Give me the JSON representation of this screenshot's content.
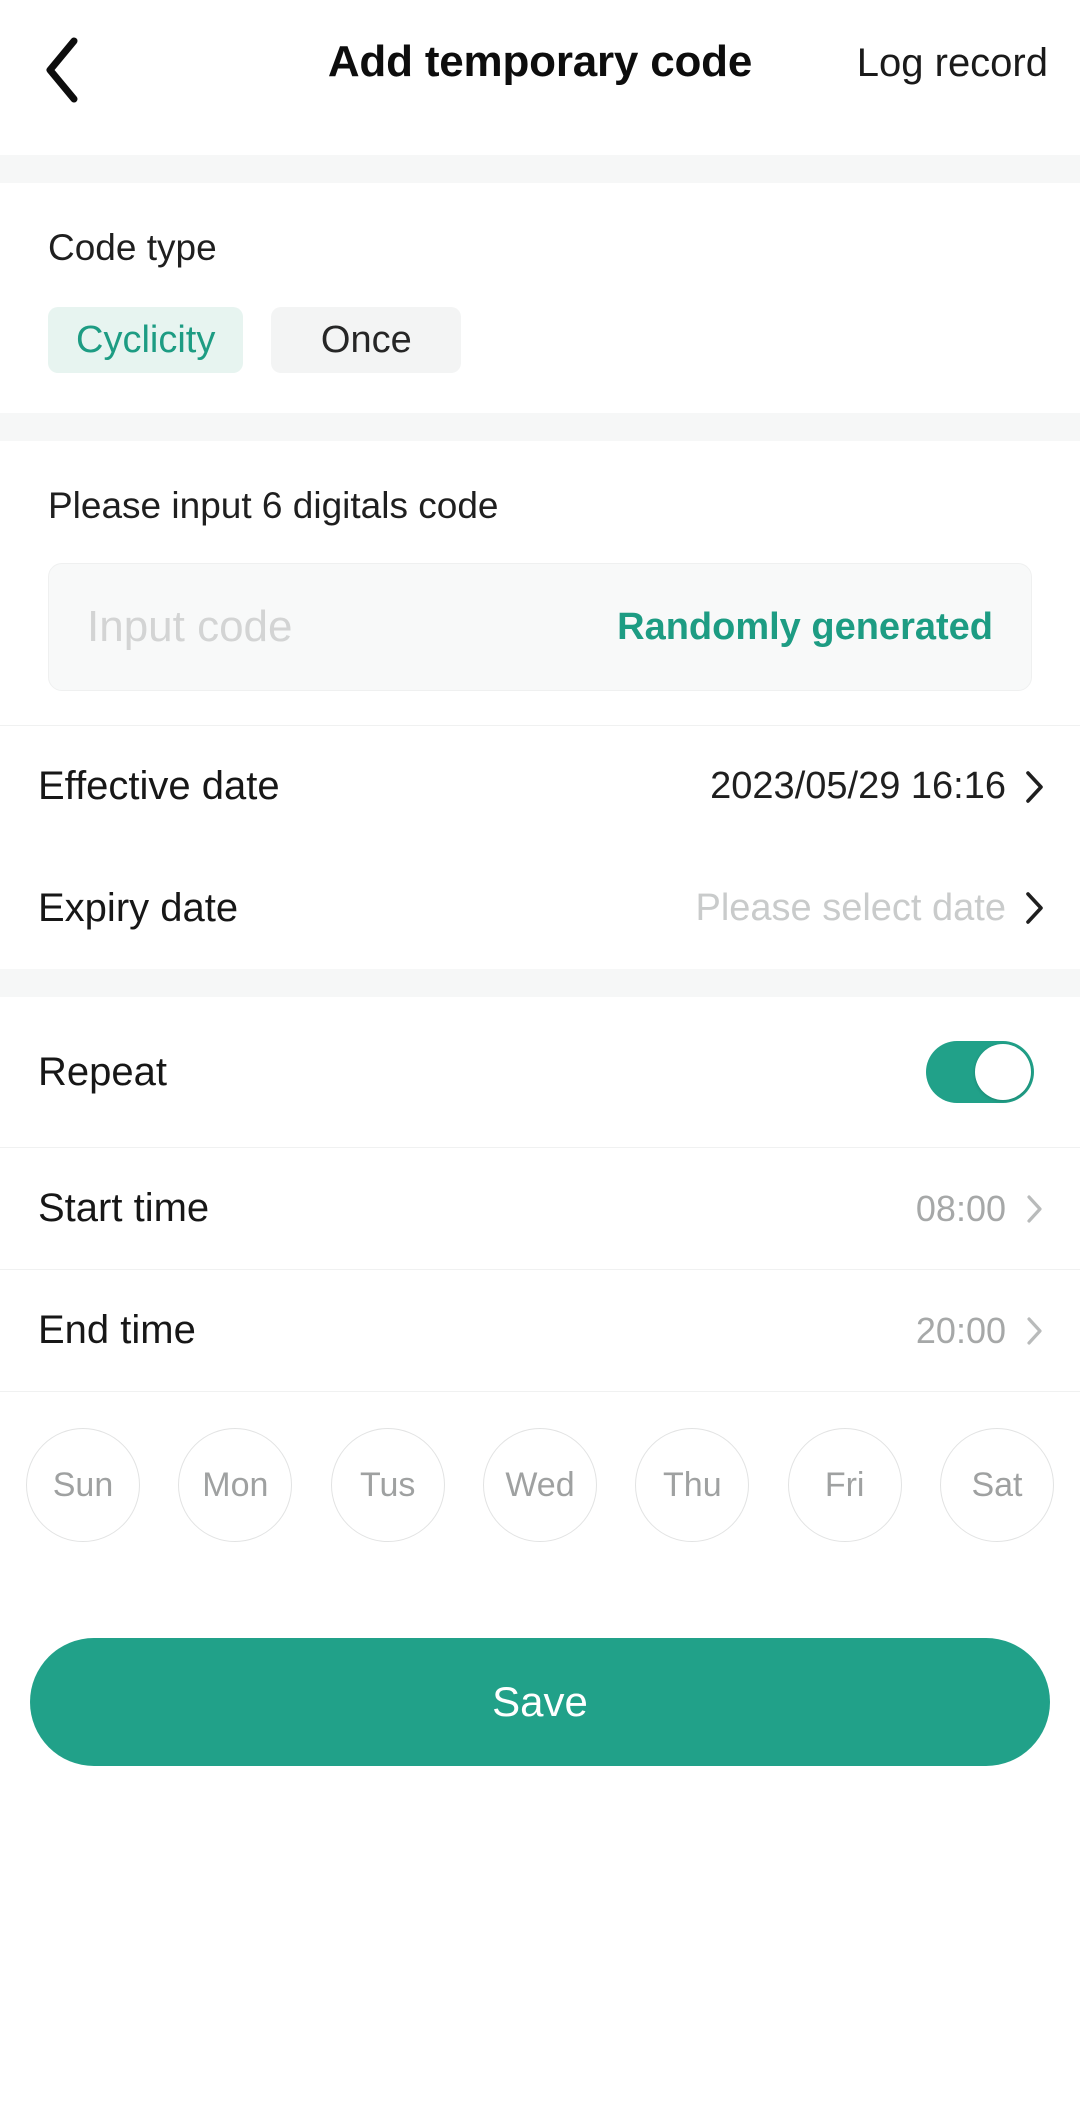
{
  "header": {
    "back_icon": "chevron-left-icon",
    "title": "Add temporary code",
    "log_record_label": "Log record"
  },
  "code_type": {
    "label": "Code type",
    "options": [
      {
        "label": "Cyclicity",
        "selected": true
      },
      {
        "label": "Once",
        "selected": false
      }
    ]
  },
  "code_input": {
    "hint": "Please input 6 digitals code",
    "value": "",
    "placeholder": "Input code",
    "random_button_label": "Randomly generated"
  },
  "dates": {
    "effective": {
      "label": "Effective date",
      "value": "2023/05/29 16:16",
      "is_placeholder": false
    },
    "expiry": {
      "label": "Expiry date",
      "value": "Please select date",
      "is_placeholder": true
    }
  },
  "repeat": {
    "label": "Repeat",
    "enabled": true,
    "start_time": {
      "label": "Start time",
      "value": "08:00"
    },
    "end_time": {
      "label": "End time",
      "value": "20:00"
    },
    "days": [
      {
        "label": "Sun",
        "selected": false
      },
      {
        "label": "Mon",
        "selected": false
      },
      {
        "label": "Tus",
        "selected": false
      },
      {
        "label": "Wed",
        "selected": false
      },
      {
        "label": "Thu",
        "selected": false
      },
      {
        "label": "Fri",
        "selected": false
      },
      {
        "label": "Sat",
        "selected": false
      }
    ]
  },
  "footer": {
    "save_label": "Save"
  },
  "colors": {
    "accent": "#21a189",
    "accent_text": "#1d9c83",
    "accent_soft_bg": "#e7f4f0",
    "neutral_bg": "#f3f4f4",
    "section_gap": "#f6f7f7"
  }
}
